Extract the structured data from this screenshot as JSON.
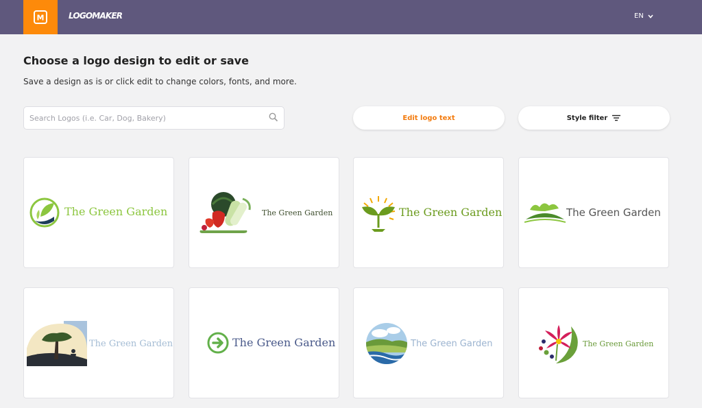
{
  "header": {
    "brand_letter": "M",
    "brand_name": "LOGOMAKER",
    "language": "EN"
  },
  "page": {
    "title": "Choose a logo design to edit or save",
    "subtitle": "Save a design as is or click edit to change colors, fonts, and more."
  },
  "search": {
    "placeholder": "Search Logos (i.e. Car, Dog, Bakery)",
    "value": ""
  },
  "toolbar": {
    "edit_label": "Edit logo text",
    "style_label": "Style filter"
  },
  "logos": [
    {
      "text": "The Green Garden",
      "color": "#8cc63f"
    },
    {
      "text": "The Green Garden",
      "color": "#3f4f2f"
    },
    {
      "text": "The Green Garden",
      "color": "#6b9b1e"
    },
    {
      "text": "The Green Garden",
      "color": "#555555"
    },
    {
      "text": "The Green Garden",
      "color": "#a4bcd4"
    },
    {
      "text": "The Green Garden",
      "color": "#4a5a8a"
    },
    {
      "text": "The Green Garden",
      "color": "#9cb4d0"
    },
    {
      "text": "The Green Garden",
      "color": "#6a9a3a"
    }
  ],
  "colors": {
    "topbar": "#5f587d",
    "brand_accent": "#fd8a0a",
    "edit_text": "#f37b0e",
    "background": "#f2f2f3"
  },
  "icons": {
    "search": "search-icon",
    "chevron": "chevron-down-icon",
    "filter": "filter-lines-icon"
  }
}
